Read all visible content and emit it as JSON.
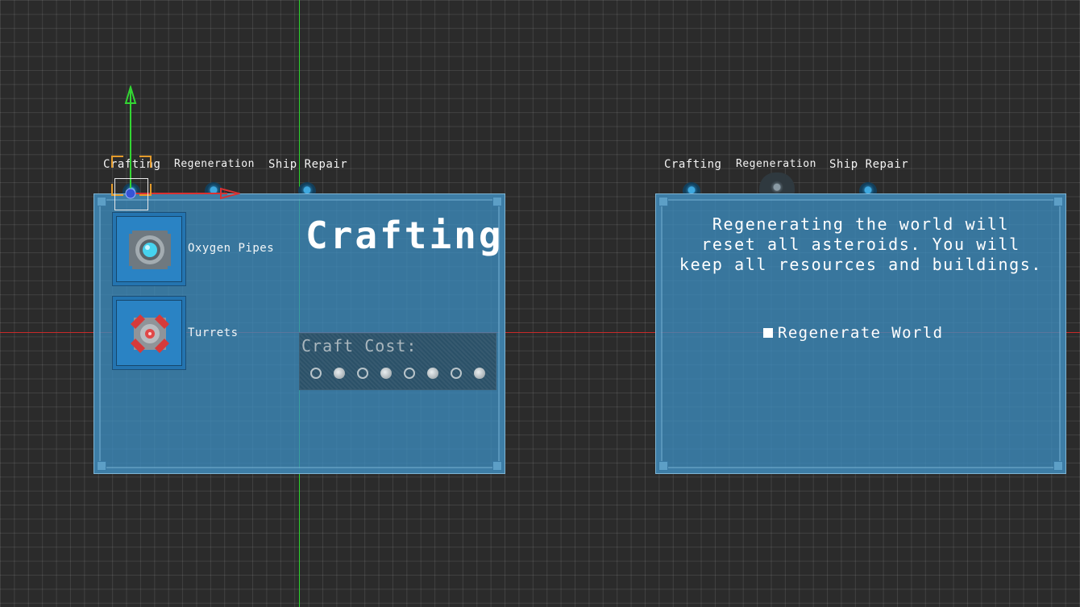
{
  "left_ui": {
    "tabs": [
      "Crafting",
      "Regeneration",
      "Ship Repair"
    ],
    "items": [
      {
        "label": "Oxygen Pipes",
        "icon": "oxygen-pipe-icon"
      },
      {
        "label": "Turrets",
        "icon": "turret-icon"
      }
    ],
    "title": "Crafting",
    "craft_cost": {
      "label": "Craft Cost:",
      "slots": [
        "empty",
        "filled",
        "empty",
        "filled",
        "empty",
        "filled",
        "empty",
        "filled"
      ]
    }
  },
  "right_ui": {
    "tabs": [
      "Crafting",
      "Regeneration",
      "Ship Repair"
    ],
    "message_lines": [
      "Regenerating the world will",
      "reset all asteroids. You will",
      "keep all resources and buildings."
    ],
    "regenerate_button": "Regenerate World"
  },
  "colors": {
    "panel": "#3c8cbe",
    "grid": "#2b2b2b",
    "y_axis": "#2ed22e",
    "x_axis": "#c82a2a",
    "selection": "#e49b2b"
  }
}
